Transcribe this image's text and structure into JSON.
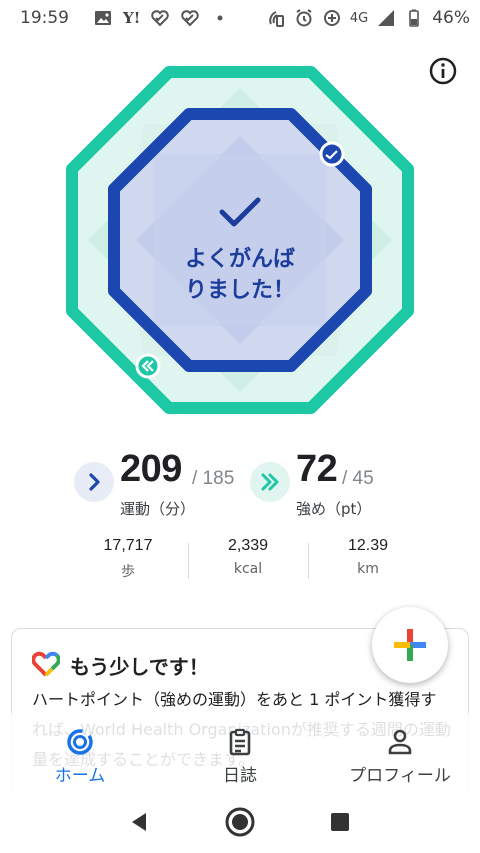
{
  "status_bar": {
    "time": "19:59",
    "yahoo_text": "Y!",
    "network": "4G",
    "battery": "46%"
  },
  "ring": {
    "message_line1": "よくがんば",
    "message_line2": "りました！",
    "colors": {
      "outer": "#1ec8a4",
      "inner": "#1c47b0"
    }
  },
  "stats": {
    "move_minutes": {
      "value": "209",
      "goal": "/ 185",
      "label": "運動（分）",
      "icon": "chevron-right-icon"
    },
    "heart_points": {
      "value": "72",
      "goal": "/ 45",
      "label": "強め（pt）",
      "icon": "double-chevron-right-icon"
    }
  },
  "metrics": [
    {
      "value": "17,717",
      "unit": "歩"
    },
    {
      "value": "2,339",
      "unit": "kcal"
    },
    {
      "value": "12.39",
      "unit": "km"
    }
  ],
  "card": {
    "title": "もう少しです！",
    "body": "ハートポイント（強めの運動）をあと 1 ポイント獲得すれば、World Health Organizationが推奨する週間の運動量を達成することができます。"
  },
  "bottom_nav": {
    "tabs": [
      {
        "label": "ホーム",
        "icon": "home-ring-icon",
        "active": true
      },
      {
        "label": "日誌",
        "icon": "journal-icon",
        "active": false
      },
      {
        "label": "プロフィール",
        "icon": "profile-icon",
        "active": false
      }
    ]
  },
  "system_nav": {
    "buttons": [
      "back-icon",
      "home-icon",
      "recents-icon"
    ]
  }
}
